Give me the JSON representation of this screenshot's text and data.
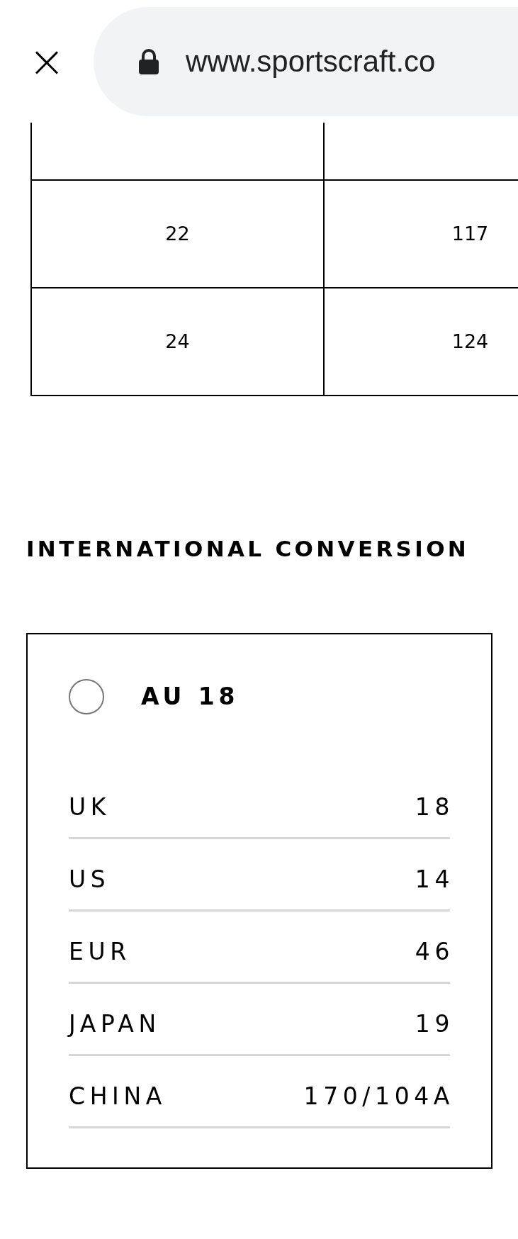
{
  "browser_bar": {
    "close": "×",
    "url": "www.sportscraft.co"
  },
  "size_table": {
    "rows": [
      {
        "column_1": "",
        "column_2": ""
      },
      {
        "column_1": "22",
        "column_2": "117"
      },
      {
        "column_1": "24",
        "column_2": "124"
      }
    ]
  },
  "international_conversion": {
    "title": "INTERNATIONAL CONVERSION",
    "option": {
      "label": "AU 18",
      "selected": false
    },
    "rows": [
      {
        "region": "UK",
        "size": "18"
      },
      {
        "region": "US",
        "size": "14"
      },
      {
        "region": "EUR",
        "size": "46"
      },
      {
        "region": "JAPAN",
        "size": "19"
      },
      {
        "region": "CHINA",
        "size": "170/104A"
      }
    ]
  }
}
